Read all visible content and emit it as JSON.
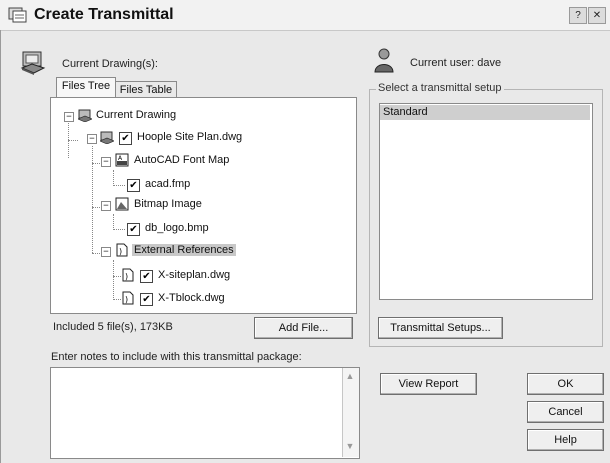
{
  "window": {
    "title": "Create Transmittal",
    "help_glyph": "?",
    "close_glyph": "✕"
  },
  "left": {
    "current_drawings_label": "Current Drawing(s):",
    "tabs": [
      {
        "label": "Files Tree",
        "active": true
      },
      {
        "label": "Files Table",
        "active": false
      }
    ],
    "tree": {
      "root": "Current Drawing",
      "drawing": "Hoople Site Plan.dwg",
      "font_map_group": "AutoCAD Font Map",
      "font_map_file": "acad.fmp",
      "bitmap_group": "Bitmap Image",
      "bitmap_file": "db_logo.bmp",
      "xref_group": "External References",
      "xref_file_1": "X-siteplan.dwg",
      "xref_file_2": "X-Tblock.dwg"
    },
    "status": "Included 5 file(s), 173KB",
    "add_file_button": "Add File...",
    "notes_label": "Enter notes to include with this transmittal package:",
    "notes_value": ""
  },
  "right": {
    "current_user_label": "Current user: dave",
    "setup_group_label": "Select a transmittal setup",
    "setups": [
      "Standard"
    ],
    "transmittal_setups_button": "Transmittal Setups...",
    "view_report_button": "View Report",
    "ok_button": "OK",
    "cancel_button": "Cancel",
    "help_button": "Help"
  }
}
